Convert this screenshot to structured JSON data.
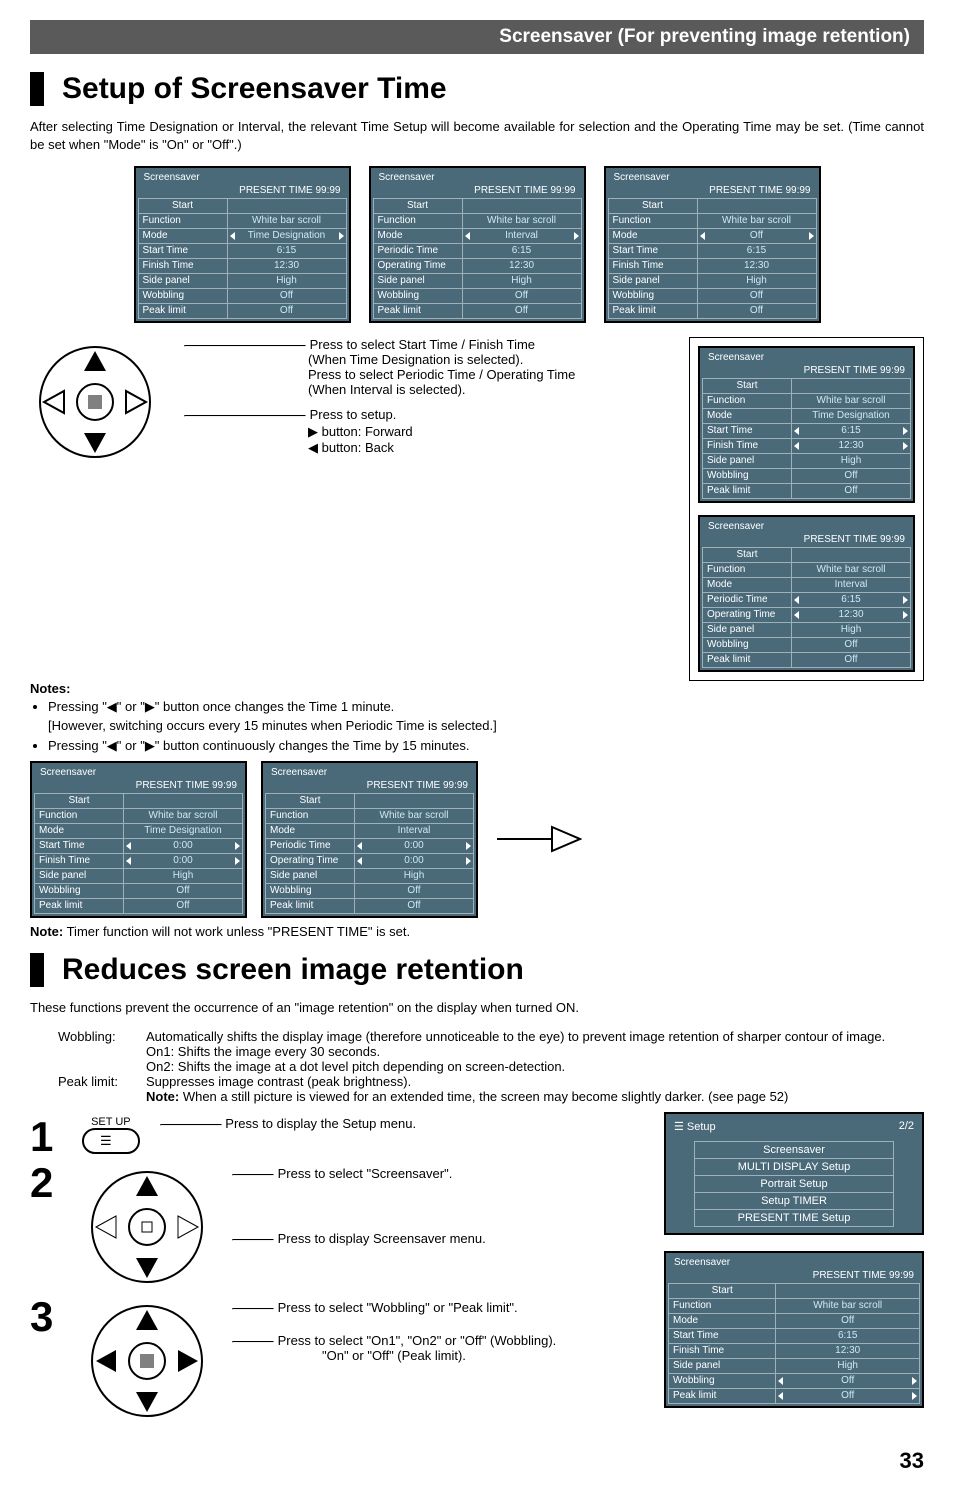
{
  "topbar": "Screensaver (For preventing image retention)",
  "heading1": "Setup of Screensaver Time",
  "intro1": "After selecting Time Designation or Interval, the relevant Time Setup will become available for selection and the Operating Time may be set. (Time cannot be set when \"Mode\" is \"On\" or \"Off\".)",
  "osd_common": {
    "title": "Screensaver",
    "present": "PRESENT  TIME    99:99",
    "start": "Start"
  },
  "rows_labels": {
    "function": "Function",
    "mode": "Mode",
    "start_time": "Start Time",
    "finish_time": "Finish Time",
    "periodic_time": "Periodic Time",
    "operating_time": "Operating Time",
    "side_panel": "Side panel",
    "wobbling": "Wobbling",
    "peak_limit": "Peak limit"
  },
  "panelA": {
    "mode": "Time Designation",
    "start": "6:15",
    "finish": "12:30",
    "func": "White bar scroll",
    "side": "High",
    "wob": "Off",
    "peak": "Off"
  },
  "panelB": {
    "mode": "Interval",
    "periodic": "6:15",
    "operating": "12:30",
    "func": "White bar scroll",
    "side": "High",
    "wob": "Off",
    "peak": "Off"
  },
  "panelC": {
    "mode": "Off",
    "start": "6:15",
    "finish": "12:30",
    "func": "White bar scroll",
    "side": "High",
    "wob": "Off",
    "peak": "Off"
  },
  "panelD": {
    "mode": "Time Designation",
    "start": "0:00",
    "finish": "0:00",
    "func": "White bar scroll",
    "side": "High",
    "wob": "Off",
    "peak": "Off"
  },
  "panelE": {
    "mode": "Interval",
    "periodic": "0:00",
    "operating": "0:00",
    "func": "White bar scroll",
    "side": "High",
    "wob": "Off",
    "peak": "Off"
  },
  "panelF": {
    "mode": "Time Designation",
    "start": "6:15",
    "finish": "12:30",
    "func": "White bar scroll",
    "side": "High",
    "wob": "Off",
    "peak": "Off"
  },
  "panelG": {
    "mode": "Interval",
    "periodic": "6:15",
    "operating": "12:30",
    "func": "White bar scroll",
    "side": "High",
    "wob": "Off",
    "peak": "Off"
  },
  "panelH": {
    "mode": "Off",
    "start": "6:15",
    "finish": "12:30",
    "func": "White bar scroll",
    "side": "High",
    "wob": "Off",
    "peak": "Off"
  },
  "instr": {
    "l1": "Press to select Start Time / Finish Time",
    "l1b": "(When Time Designation is selected).",
    "l2": "Press to select Periodic Time / Operating Time",
    "l2b": "(When Interval is selected).",
    "l3": "Press to setup.",
    "fwd": "▶ button: Forward",
    "back": "◀ button: Back"
  },
  "notes_label": "Notes:",
  "note_b1a": "Pressing \"◀\" or \"▶\" button once changes the Time 1 minute.",
  "note_b1b": "[However, switching occurs every 15 minutes when Periodic Time is selected.]",
  "note_b2": "Pressing \"◀\" or \"▶\" button continuously changes the Time by 15 minutes.",
  "timer_note_label": "Note:",
  "timer_note_text": " Timer function will not work unless \"PRESENT TIME\" is set.",
  "heading2": "Reduces screen image retention",
  "intro2": "These functions prevent the occurrence of an \"image retention\" on the display when turned ON.",
  "wobbling_label": "Wobbling:",
  "wobbling_desc": "Automatically shifts the display image (therefore unnoticeable to the eye) to prevent image retention of sharper contour of image.",
  "wobbling_on1": "On1: Shifts the image every 30 seconds.",
  "wobbling_on2": "On2: Shifts the image at a dot level pitch depending on screen-detection.",
  "peak_label": "Peak limit:",
  "peak_desc": "Suppresses image contrast (peak brightness).",
  "peak_note_label": "Note:",
  "peak_note_text": " When a still picture is viewed for an extended time, the screen may become slightly darker. (see page 52)",
  "step1": {
    "key": "SET UP",
    "cap": "Press to display the Setup menu."
  },
  "step2": {
    "capA": "Press to select \"Screensaver\".",
    "capB": "Press to display Screensaver menu."
  },
  "step3": {
    "capA": "Press to select \"Wobbling\" or \"Peak limit\".",
    "capB": "Press to select \"On1\", \"On2\" or \"Off\" (Wobbling).",
    "capC": "\"On\" or \"Off\" (Peak limit)."
  },
  "setupmenu": {
    "hdr_left": "Setup",
    "hdr_right": "2/2",
    "items": [
      "Screensaver",
      "MULTI DISPLAY Setup",
      "Portrait Setup",
      "Setup TIMER",
      "PRESENT TIME Setup"
    ]
  },
  "page_number": "33"
}
